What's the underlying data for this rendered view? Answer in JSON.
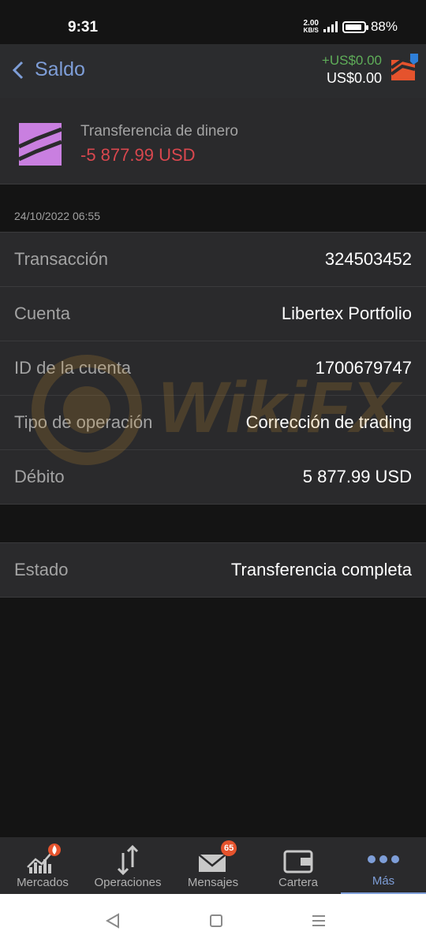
{
  "status_bar": {
    "time": "9:31",
    "net_speed_value": "2.00",
    "net_speed_unit": "KB/S",
    "battery": "88%"
  },
  "header": {
    "back_label": "Saldo",
    "balance_change": "+US$0.00",
    "balance": "US$0.00"
  },
  "transfer": {
    "label": "Transferencia de dinero",
    "amount": "-5 877.99 USD"
  },
  "date": "24/10/2022 06:55",
  "details": [
    {
      "label": "Transacción",
      "value": "324503452"
    },
    {
      "label": "Cuenta",
      "value": "Libertex Portfolio"
    },
    {
      "label": "ID de la cuenta",
      "value": "1700679747"
    },
    {
      "label": "Tipo de operación",
      "value": "Corrección de trading"
    },
    {
      "label": "Débito",
      "value": "5 877.99 USD"
    }
  ],
  "status_row": {
    "label": "Estado",
    "value": "Transferencia completa"
  },
  "watermark": "WikiFX",
  "bottom_nav": [
    {
      "label": "Mercados",
      "icon": "markets-fire-icon"
    },
    {
      "label": "Operaciones",
      "icon": "updown-arrows-icon"
    },
    {
      "label": "Mensajes",
      "icon": "envelope-icon",
      "badge": "65"
    },
    {
      "label": "Cartera",
      "icon": "wallet-icon"
    },
    {
      "label": "Más",
      "icon": "more-dots-icon",
      "active": true
    }
  ],
  "colors": {
    "accent": "#7e9ed8",
    "negative": "#d9474e",
    "positive": "#5fae59",
    "badge": "#e5532d",
    "transfer_icon_bg": "#c97fe0"
  }
}
